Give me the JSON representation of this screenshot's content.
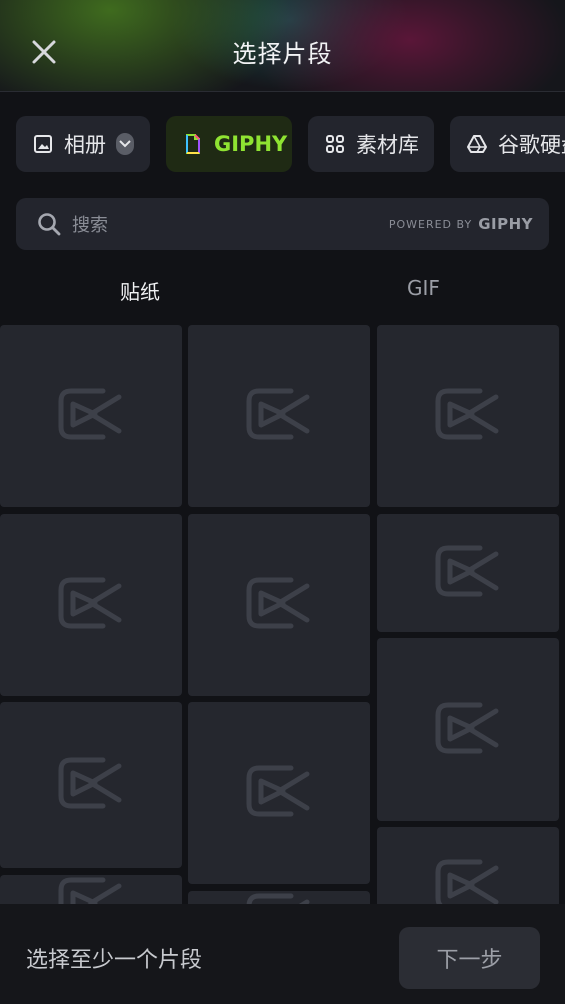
{
  "header": {
    "title": "选择片段",
    "close_icon": "close-icon"
  },
  "source_tabs": [
    {
      "label": "相册",
      "icon": "image-icon",
      "has_dropdown": true
    },
    {
      "label": "GIPHY",
      "icon": "giphy-icon",
      "selected": true
    },
    {
      "label": "素材库",
      "icon": "grid-icon"
    },
    {
      "label": "谷歌硬盘",
      "icon": "google-drive-icon"
    }
  ],
  "search": {
    "placeholder": "搜索",
    "powered_by": "POWERED BY",
    "powered_brand": "GIPHY"
  },
  "segments": {
    "stickers": "贴纸",
    "gif": "GIF",
    "selected": "stickers"
  },
  "colors": {
    "accent": "#8fe332",
    "background": "#111216",
    "tile": "#25272e"
  },
  "footer": {
    "hint": "选择至少一个片段",
    "next_label": "下一步"
  }
}
